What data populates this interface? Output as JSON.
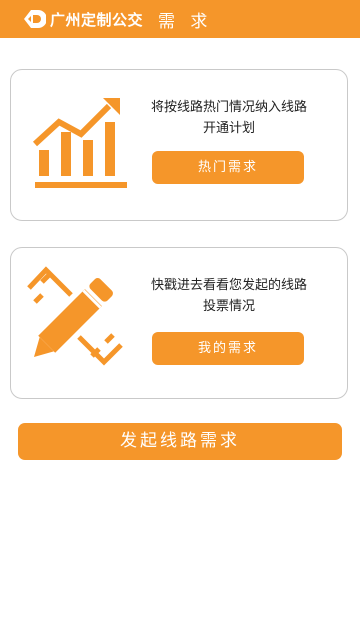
{
  "header": {
    "logo_text": "广州定制公交",
    "title": "需 求"
  },
  "cards": [
    {
      "description": "将按线路热门情况纳入线路开通计划",
      "button_label": "热门需求",
      "icon": "trending-chart-icon"
    },
    {
      "description": "快戳进去看看您发起的线路投票情况",
      "button_label": "我的需求",
      "icon": "pencil-icon"
    }
  ],
  "main_action": {
    "label": "发起线路需求"
  },
  "colors": {
    "accent": "#f5962a",
    "border": "#c9c9c9",
    "text": "#222222"
  }
}
